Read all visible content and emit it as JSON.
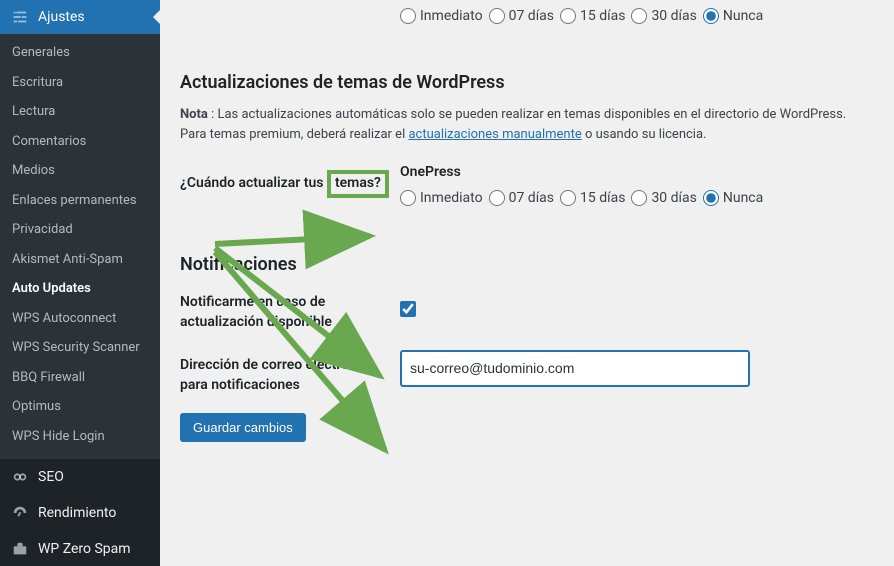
{
  "sidebar": {
    "top_label": "Ajustes",
    "submenu": [
      "Generales",
      "Escritura",
      "Lectura",
      "Comentarios",
      "Medios",
      "Enlaces permanentes",
      "Privacidad",
      "Akismet Anti-Spam",
      "Auto Updates",
      "WPS Autoconnect",
      "WPS Security Scanner",
      "BBQ Firewall",
      "Optimus",
      "WPS Hide Login"
    ],
    "current_submenu_index": 8,
    "bottom_items": [
      {
        "label": "SEO",
        "icon": "seo"
      },
      {
        "label": "Rendimiento",
        "icon": "gauge"
      },
      {
        "label": "WP Zero Spam",
        "icon": "briefcase"
      }
    ]
  },
  "content": {
    "top_radio_options": [
      "Inmediato",
      "07 días",
      "15 días",
      "30 días",
      "Nunca"
    ],
    "top_radio_selected_index": 4,
    "themes_section": {
      "title": "Actualizaciones de temas de WordPress",
      "note_prefix": "Nota",
      "note_text_1": " : Las actualizaciones automáticas solo se pueden realizar en temas disponibles en el directorio de WordPress. Para temas premium, deberá realizar el ",
      "note_link": "actualizaciones manualmente",
      "note_text_2": " o usando su licencia.",
      "when_label_prefix": "¿Cuándo actualizar tus ",
      "when_label_highlight": "temas?",
      "theme_name": "OnePress",
      "theme_radio_options": [
        "Inmediato",
        "07 días",
        "15 días",
        "30 días",
        "Nunca"
      ],
      "theme_radio_selected_index": 4
    },
    "notifications_section": {
      "title": "Notificaciones",
      "notify_label": "Notificarme en caso de actualización disponible",
      "notify_checked": true,
      "email_label": "Dirección de correo electrónico para notificaciones",
      "email_value": "su-correo@tudominio.com"
    },
    "save_button": "Guardar cambios"
  }
}
